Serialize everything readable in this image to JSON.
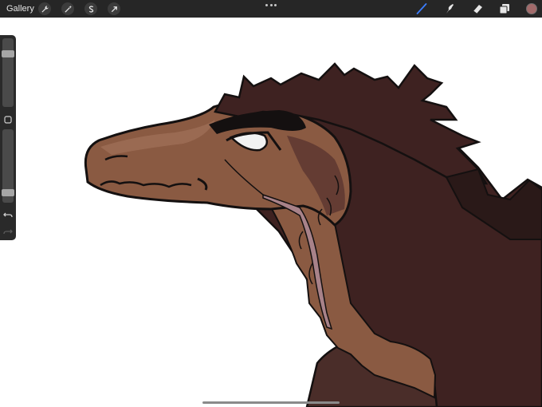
{
  "topbar": {
    "gallery_label": "Gallery",
    "actions": [
      {
        "name": "actions-button",
        "icon": "wrench-icon"
      },
      {
        "name": "adjustments-button",
        "icon": "magic-wand-icon"
      },
      {
        "name": "selection-button",
        "icon": "selection-s-icon"
      },
      {
        "name": "transform-button",
        "icon": "arrow-cursor-icon"
      }
    ],
    "more_icon": "ellipsis-icon",
    "tools": [
      {
        "name": "brush-tool",
        "icon": "brush-icon",
        "active": true,
        "active_color": "#3b7dff"
      },
      {
        "name": "smudge-tool",
        "icon": "smudge-icon",
        "active": false
      },
      {
        "name": "eraser-tool",
        "icon": "eraser-icon",
        "active": false
      },
      {
        "name": "layers-tool",
        "icon": "layers-icon",
        "active": false
      }
    ],
    "current_color": "#a36b6b"
  },
  "sidebar": {
    "brush_size_level": 0.8,
    "brush_opacity_level": 0.1,
    "modify_icon": "square-icon",
    "undo_icon": "undo-icon",
    "redo_icon": "redo-icon",
    "redo_enabled": false
  },
  "canvas": {
    "artwork": "dragon-head-illustration",
    "colors": {
      "skin": "#8a5a42",
      "skin_light": "#a1705a",
      "mane": "#3e2221",
      "mane_dark": "#2a1918",
      "body": "#4a2d29",
      "scar": "#a88289",
      "outline": "#141010",
      "eye": "#f2f2f2"
    }
  }
}
